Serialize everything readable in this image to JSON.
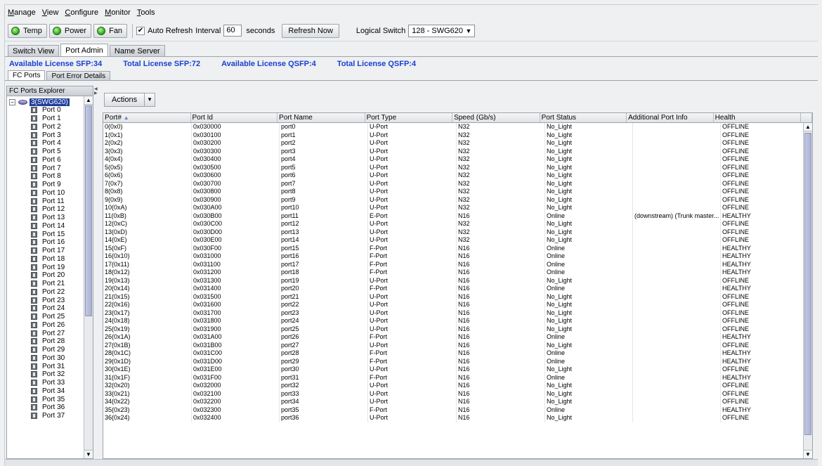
{
  "menu": [
    "Manage",
    "View",
    "Configure",
    "Monitor",
    "Tools"
  ],
  "toolbar": {
    "temp_label": "Temp",
    "power_label": "Power",
    "fan_label": "Fan",
    "auto_refresh_label": "Auto Refresh",
    "auto_refresh_checked": "✔",
    "interval_label": "Interval",
    "interval_value": "60",
    "seconds_label": "seconds",
    "refresh_now_label": "Refresh Now",
    "logical_switch_label": "Logical Switch",
    "logical_switch_value": "128 - SWG620",
    "led_color": "#2aa51a"
  },
  "tabs": [
    "Switch View",
    "Port Admin",
    "Name Server"
  ],
  "active_tab": "Port Admin",
  "license": {
    "available_sfp": "Available License SFP:34",
    "total_sfp": "Total License SFP:72",
    "available_qsfp": "Available License QSFP:4",
    "total_qsfp": "Total License QSFP:4",
    "color": "#1a3fd1"
  },
  "subtabs": [
    "FC Ports",
    "Port Error Details"
  ],
  "active_subtab": "FC Ports",
  "explorer": {
    "title": "FC Ports Explorer",
    "root_label": "3(SWG620)",
    "items": [
      "Port 0",
      "Port 1",
      "Port 2",
      "Port 3",
      "Port 4",
      "Port 5",
      "Port 6",
      "Port 7",
      "Port 8",
      "Port 9",
      "Port 10",
      "Port 11",
      "Port 12",
      "Port 13",
      "Port 14",
      "Port 15",
      "Port 16",
      "Port 17",
      "Port 18",
      "Port 19",
      "Port 20",
      "Port 21",
      "Port 22",
      "Port 23",
      "Port 24",
      "Port 25",
      "Port 26",
      "Port 27",
      "Port 28",
      "Port 29",
      "Port 30",
      "Port 31",
      "Port 32",
      "Port 33",
      "Port 34",
      "Port 35",
      "Port 36",
      "Port 37"
    ]
  },
  "actions_label": "Actions",
  "table": {
    "columns": [
      "Port#",
      "Port Id",
      "Port Name",
      "Port Type",
      "Speed (Gb/s)",
      "Port Status",
      "Additional Port Info",
      "Health"
    ],
    "sort_indicator": "▲",
    "rows": [
      [
        "0(0x0)",
        "0x030000",
        "port0",
        "U-Port",
        "N32",
        "No_Light",
        "",
        "OFFLINE"
      ],
      [
        "1(0x1)",
        "0x030100",
        "port1",
        "U-Port",
        "N32",
        "No_Light",
        "",
        "OFFLINE"
      ],
      [
        "2(0x2)",
        "0x030200",
        "port2",
        "U-Port",
        "N32",
        "No_Light",
        "",
        "OFFLINE"
      ],
      [
        "3(0x3)",
        "0x030300",
        "port3",
        "U-Port",
        "N32",
        "No_Light",
        "",
        "OFFLINE"
      ],
      [
        "4(0x4)",
        "0x030400",
        "port4",
        "U-Port",
        "N32",
        "No_Light",
        "",
        "OFFLINE"
      ],
      [
        "5(0x5)",
        "0x030500",
        "port5",
        "U-Port",
        "N32",
        "No_Light",
        "",
        "OFFLINE"
      ],
      [
        "6(0x6)",
        "0x030600",
        "port6",
        "U-Port",
        "N32",
        "No_Light",
        "",
        "OFFLINE"
      ],
      [
        "7(0x7)",
        "0x030700",
        "port7",
        "U-Port",
        "N32",
        "No_Light",
        "",
        "OFFLINE"
      ],
      [
        "8(0x8)",
        "0x030800",
        "port8",
        "U-Port",
        "N32",
        "No_Light",
        "",
        "OFFLINE"
      ],
      [
        "9(0x9)",
        "0x030900",
        "port9",
        "U-Port",
        "N32",
        "No_Light",
        "",
        "OFFLINE"
      ],
      [
        "10(0xA)",
        "0x030A00",
        "port10",
        "U-Port",
        "N32",
        "No_Light",
        "",
        "OFFLINE"
      ],
      [
        "11(0xB)",
        "0x030B00",
        "port11",
        "E-Port",
        "N16",
        "Online",
        "(downstream) (Trunk master...",
        "HEALTHY"
      ],
      [
        "12(0xC)",
        "0x030C00",
        "port12",
        "U-Port",
        "N32",
        "No_Light",
        "",
        "OFFLINE"
      ],
      [
        "13(0xD)",
        "0x030D00",
        "port13",
        "U-Port",
        "N32",
        "No_Light",
        "",
        "OFFLINE"
      ],
      [
        "14(0xE)",
        "0x030E00",
        "port14",
        "U-Port",
        "N32",
        "No_Light",
        "",
        "OFFLINE"
      ],
      [
        "15(0xF)",
        "0x030F00",
        "port15",
        "F-Port",
        "N16",
        "Online",
        "",
        "HEALTHY"
      ],
      [
        "16(0x10)",
        "0x031000",
        "port16",
        "F-Port",
        "N16",
        "Online",
        "",
        "HEALTHY"
      ],
      [
        "17(0x11)",
        "0x031100",
        "port17",
        "F-Port",
        "N16",
        "Online",
        "",
        "HEALTHY"
      ],
      [
        "18(0x12)",
        "0x031200",
        "port18",
        "F-Port",
        "N16",
        "Online",
        "",
        "HEALTHY"
      ],
      [
        "19(0x13)",
        "0x031300",
        "port19",
        "U-Port",
        "N16",
        "No_Light",
        "",
        "OFFLINE"
      ],
      [
        "20(0x14)",
        "0x031400",
        "port20",
        "F-Port",
        "N16",
        "Online",
        "",
        "HEALTHY"
      ],
      [
        "21(0x15)",
        "0x031500",
        "port21",
        "U-Port",
        "N16",
        "No_Light",
        "",
        "OFFLINE"
      ],
      [
        "22(0x16)",
        "0x031600",
        "port22",
        "U-Port",
        "N16",
        "No_Light",
        "",
        "OFFLINE"
      ],
      [
        "23(0x17)",
        "0x031700",
        "port23",
        "U-Port",
        "N16",
        "No_Light",
        "",
        "OFFLINE"
      ],
      [
        "24(0x18)",
        "0x031800",
        "port24",
        "U-Port",
        "N16",
        "No_Light",
        "",
        "OFFLINE"
      ],
      [
        "25(0x19)",
        "0x031900",
        "port25",
        "U-Port",
        "N16",
        "No_Light",
        "",
        "OFFLINE"
      ],
      [
        "26(0x1A)",
        "0x031A00",
        "port26",
        "F-Port",
        "N16",
        "Online",
        "",
        "HEALTHY"
      ],
      [
        "27(0x1B)",
        "0x031B00",
        "port27",
        "U-Port",
        "N16",
        "No_Light",
        "",
        "OFFLINE"
      ],
      [
        "28(0x1C)",
        "0x031C00",
        "port28",
        "F-Port",
        "N16",
        "Online",
        "",
        "HEALTHY"
      ],
      [
        "29(0x1D)",
        "0x031D00",
        "port29",
        "F-Port",
        "N16",
        "Online",
        "",
        "HEALTHY"
      ],
      [
        "30(0x1E)",
        "0x031E00",
        "port30",
        "U-Port",
        "N16",
        "No_Light",
        "",
        "OFFLINE"
      ],
      [
        "31(0x1F)",
        "0x031F00",
        "port31",
        "F-Port",
        "N16",
        "Online",
        "",
        "HEALTHY"
      ],
      [
        "32(0x20)",
        "0x032000",
        "port32",
        "U-Port",
        "N16",
        "No_Light",
        "",
        "OFFLINE"
      ],
      [
        "33(0x21)",
        "0x032100",
        "port33",
        "U-Port",
        "N16",
        "No_Light",
        "",
        "OFFLINE"
      ],
      [
        "34(0x22)",
        "0x032200",
        "port34",
        "U-Port",
        "N16",
        "No_Light",
        "",
        "OFFLINE"
      ],
      [
        "35(0x23)",
        "0x032300",
        "port35",
        "F-Port",
        "N16",
        "Online",
        "",
        "HEALTHY"
      ],
      [
        "36(0x24)",
        "0x032400",
        "port36",
        "U-Port",
        "N16",
        "No_Light",
        "",
        "OFFLINE"
      ]
    ]
  }
}
